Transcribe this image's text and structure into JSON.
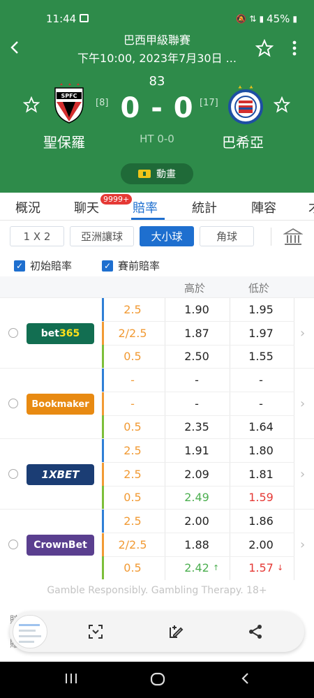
{
  "status": {
    "time": "11:44",
    "battery": "45%"
  },
  "match": {
    "league": "巴西甲級聯賽",
    "datetime": "下午10:00, 2023年7月30日 ...",
    "minute": "83",
    "score": "0 - 0",
    "halftime": "HT 0-0",
    "home": {
      "name": "聖保羅",
      "rank": "[8]",
      "crest_text": "SPFC"
    },
    "away": {
      "name": "巴希亞",
      "rank": "[17]"
    },
    "animation_label": "動畫"
  },
  "tabs": [
    {
      "label": "概況"
    },
    {
      "label": "聊天",
      "badge": "9999+"
    },
    {
      "label": "賠率"
    },
    {
      "label": "統計"
    },
    {
      "label": "陣容"
    },
    {
      "label": "才"
    }
  ],
  "filters": [
    {
      "label": "1 X 2"
    },
    {
      "label": "亞洲讓球"
    },
    {
      "label": "大小球"
    },
    {
      "label": "角球"
    }
  ],
  "checks": [
    {
      "label": "初始賠率"
    },
    {
      "label": "賽前賠率"
    }
  ],
  "columns": {
    "over": "高於",
    "under": "低於"
  },
  "bookmakers": [
    {
      "name": "bet365",
      "name_a": "bet",
      "name_b": "365",
      "bg": "#126e51",
      "rows": [
        {
          "line": "2.5",
          "over": "1.90",
          "under": "1.95"
        },
        {
          "line": "2/2.5",
          "over": "1.87",
          "under": "1.97"
        },
        {
          "line": "0.5",
          "over": "2.50",
          "under": "1.55"
        }
      ]
    },
    {
      "name": "Bookmaker",
      "bg": "#e88a12",
      "rows": [
        {
          "line": "-",
          "over": "-",
          "under": "-"
        },
        {
          "line": "-",
          "over": "-",
          "under": "-"
        },
        {
          "line": "0.5",
          "over": "2.35",
          "under": "1.64"
        }
      ]
    },
    {
      "name": "1XBET",
      "bg": "#1b3d74",
      "rows": [
        {
          "line": "2.5",
          "over": "1.91",
          "under": "1.80"
        },
        {
          "line": "2.5",
          "over": "2.09",
          "under": "1.81"
        },
        {
          "line": "0.5",
          "over": "2.49",
          "under": "1.59"
        }
      ]
    },
    {
      "name": "CrownBet",
      "bg": "#5a3f8f",
      "rows": [
        {
          "line": "2.5",
          "over": "2.00",
          "under": "1.86"
        },
        {
          "line": "2/2.5",
          "over": "1.88",
          "under": "2.00"
        },
        {
          "line": "0.5",
          "over": "2.42",
          "under": "1.57"
        }
      ]
    }
  ],
  "row_colors": [
    "#2f7fd6",
    "#f19a34",
    "#7cbf3a"
  ],
  "footer": {
    "gamble": "Gamble Responsibly. Gambling Therapy. 18+",
    "behind_1": "賠率",
    "behind_2": "賠率"
  },
  "icons": {
    "back": "back-arrow-icon",
    "star": "star-outline-icon",
    "more": "more-vert-icon",
    "bank": "bank-icon",
    "scan": "scan-icon",
    "edit": "edit-icon",
    "share": "share-icon"
  }
}
